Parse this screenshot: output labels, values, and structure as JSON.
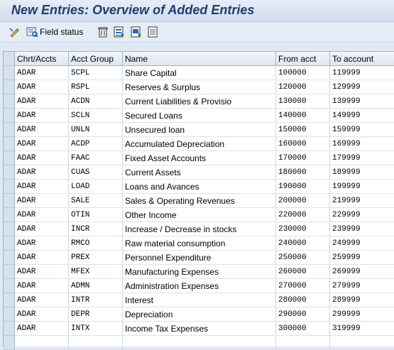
{
  "window": {
    "title": "New Entries: Overview of Added Entries"
  },
  "toolbar": {
    "items": [
      {
        "icon": "display-change-icon"
      },
      {
        "icon": "field-status-icon",
        "label": "Field status"
      },
      {
        "icon": "delete-icon"
      },
      {
        "icon": "select-all-icon"
      },
      {
        "icon": "select-block-icon"
      },
      {
        "icon": "deselect-all-icon"
      }
    ]
  },
  "table": {
    "columns": [
      "Chrt/Accts",
      "Acct Group",
      "Name",
      "From acct",
      "To account"
    ],
    "rows": [
      [
        "ADAR",
        "SCPL",
        "Share Capital",
        "100000",
        "119999"
      ],
      [
        "ADAR",
        "RSPL",
        "Reserves & Surplus",
        "120000",
        "129999"
      ],
      [
        "ADAR",
        "ACDN",
        "Current Liabilities & Provisio",
        "130000",
        "139999"
      ],
      [
        "ADAR",
        "SCLN",
        "Secured Loans",
        "140000",
        "149999"
      ],
      [
        "ADAR",
        "UNLN",
        "Unsecured loan",
        "150000",
        "159999"
      ],
      [
        "ADAR",
        "ACDP",
        "Accumulated Depreciation",
        "160000",
        "169999"
      ],
      [
        "ADAR",
        "FAAC",
        "Fixed Asset Accounts",
        "170000",
        "179999"
      ],
      [
        "ADAR",
        "CUAS",
        "Current Assets",
        "180000",
        "189999"
      ],
      [
        "ADAR",
        "LOAD",
        "Loans and Avances",
        "190000",
        "199999"
      ],
      [
        "ADAR",
        "SALE",
        "Sales & Operating Revenues",
        "200000",
        "219999"
      ],
      [
        "ADAR",
        "OTIN",
        "Other Income",
        "220000",
        "229999"
      ],
      [
        "ADAR",
        "INCR",
        "Increase / Decrease in stocks",
        "230000",
        "239999"
      ],
      [
        "ADAR",
        "RMCO",
        "Raw material consumption",
        "240000",
        "249999"
      ],
      [
        "ADAR",
        "PREX",
        "Personnel  Expenditure",
        "250000",
        "259999"
      ],
      [
        "ADAR",
        "MFEX",
        "Manufacturing Expenses",
        "260000",
        "269999"
      ],
      [
        "ADAR",
        "ADMN",
        "Administration Expenses",
        "270000",
        "279999"
      ],
      [
        "ADAR",
        "INTR",
        "Interest",
        "280000",
        "289999"
      ],
      [
        "ADAR",
        "DEPR",
        "Depreciation",
        "290000",
        "299999"
      ],
      [
        "ADAR",
        "INTX",
        "Income Tax Expenses",
        "300000",
        "319999"
      ],
      [
        "",
        "",
        "",
        "",
        ""
      ]
    ]
  }
}
